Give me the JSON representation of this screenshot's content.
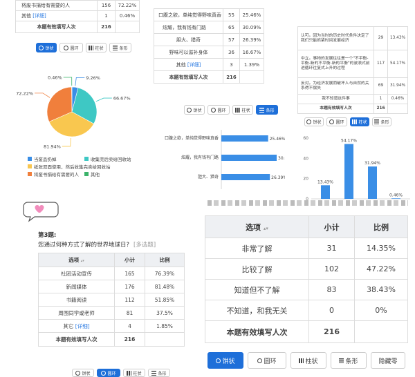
{
  "cardA": {
    "rows": [
      {
        "option": "将废书捐给有需要的人",
        "count": "156",
        "pct": "72.22%"
      },
      {
        "option": "其他",
        "link": "[详细]",
        "count": "1",
        "pct": "0.46%"
      }
    ],
    "total_label": "本题有效填写人次",
    "total_value": "216"
  },
  "buttons": {
    "pie": "饼状",
    "ring": "圆环",
    "bar": "柱状",
    "hbar": "条形",
    "hide": "隐藏零"
  },
  "pieA": {
    "legend": [
      "当废品扔掉",
      "收集完后卖给回收站",
      "纸张双面使用，然后收集完卖给回收站",
      "将废书捐给有需要的人",
      "其他"
    ],
    "colors": [
      "#3a8ee6",
      "#3ec8c4",
      "#f9c74f",
      "#f07f3c",
      "#3bb36a"
    ]
  },
  "cardB": {
    "rows": [
      {
        "option": "口腹之欲，单纯觉得野味真香",
        "count": "55",
        "pct": "25.46%"
      },
      {
        "option": "炫耀，我有钱有门路",
        "count": "65",
        "pct": "30.09%"
      },
      {
        "option": "胆大、猎奇",
        "count": "57",
        "pct": "26.39%"
      },
      {
        "option": "野味可以滋补身体",
        "count": "36",
        "pct": "16.67%"
      },
      {
        "option": "其他",
        "link": "[详细]",
        "count": "3",
        "pct": "1.39%"
      }
    ],
    "total_label": "本题有效填写人次",
    "total_value": "216"
  },
  "cardC": {
    "rows": [
      {
        "option": "认可。因为当时的历史时代条件决定了我们只能抓紧时间发展经济",
        "count": "29",
        "pct": "13.43%"
      },
      {
        "option": "中立。事物的发展往往是一个\"不平衡-平衡-新的不平衡-新的平衡\"的波浪式前进循环往复式上升的过程",
        "count": "117",
        "pct": "54.17%"
      },
      {
        "option": "反对。为经济发展而破坏人与自然的关系得不偿失",
        "count": "69",
        "pct": "31.94%"
      },
      {
        "option": "我不知道这件事",
        "count": "1",
        "pct": "0.46%"
      }
    ],
    "total_label": "本题有效填写人次",
    "total_value": "216"
  },
  "hbarB": {
    "labels": [
      "口腹之欲，单纯觉得野味真香",
      "炫耀，我有钱有门路",
      "胆大、猎奇"
    ],
    "values": [
      "25.46%",
      "30.09%",
      "26.39%"
    ]
  },
  "cardE": {
    "title": "第3题:",
    "question": "您通过何种方式了解的世界地球日?",
    "tag": "[多选题]",
    "headers": [
      "选项",
      "小计",
      "比例"
    ],
    "rows": [
      {
        "option": "社团活动宣传",
        "count": "165",
        "pct": "76.39%"
      },
      {
        "option": "新闻媒体",
        "count": "176",
        "pct": "81.48%"
      },
      {
        "option": "书籍阅读",
        "count": "112",
        "pct": "51.85%"
      },
      {
        "option": "周围同学或老师",
        "count": "81",
        "pct": "37.5%"
      },
      {
        "option": "其它",
        "link": "[详细]",
        "count": "4",
        "pct": "1.85%"
      }
    ],
    "total_label": "本题有效填写人次",
    "total_value": "216"
  },
  "cardF": {
    "headers": [
      "选项",
      "小计",
      "比例"
    ],
    "rows": [
      {
        "option": "非常了解",
        "count": "31",
        "pct": "14.35%"
      },
      {
        "option": "比较了解",
        "count": "102",
        "pct": "47.22%"
      },
      {
        "option": "知道但不了解",
        "count": "83",
        "pct": "38.43%"
      },
      {
        "option": "不知道，和我无关",
        "count": "0",
        "pct": "0%"
      }
    ],
    "total_label": "本题有效填写人次",
    "total_value": "216"
  },
  "chart_data": [
    {
      "type": "pie",
      "categories": [
        "当废品扔掉",
        "收集完后卖给回收站",
        "纸张双面使用，然后收集完卖给回收站",
        "将废书捐给有需要的人",
        "其他"
      ],
      "values": [
        9.26,
        66.67,
        81.94,
        72.22,
        0.46
      ],
      "labels": [
        "9.26%",
        "66.67%",
        "81.94%",
        "72.22%",
        "0.46%"
      ]
    },
    {
      "type": "bar",
      "categories": [
        "认可",
        "中立",
        "反对",
        "我不知道这件事"
      ],
      "values": [
        13.43,
        54.17,
        31.94,
        0.46
      ],
      "labels": [
        "13.43%",
        "54.17%",
        "31.94%",
        "0.46%"
      ],
      "yticks": [
        "0",
        "20",
        "40",
        "60"
      ],
      "ylim": [
        0,
        60
      ]
    }
  ]
}
